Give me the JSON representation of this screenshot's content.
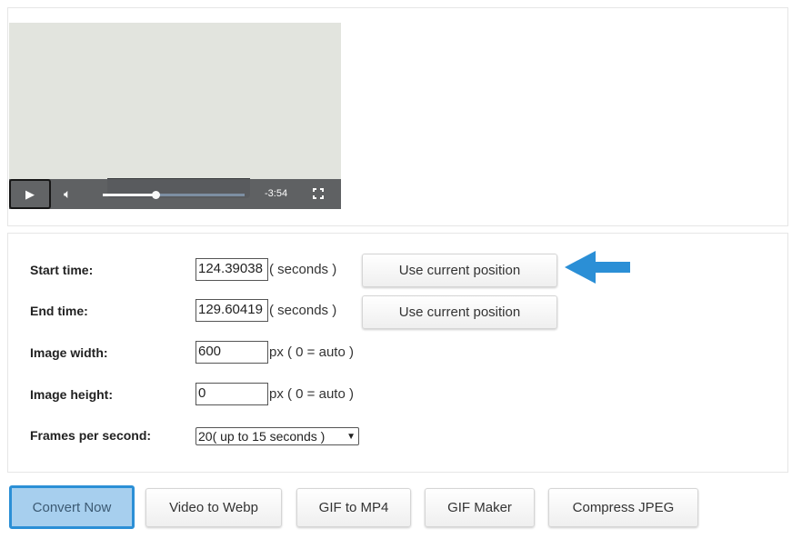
{
  "player": {
    "time_remaining": "-3:54",
    "progress_percent": 37,
    "play_icon": "play-icon",
    "volume_icon": "volume-icon",
    "fullscreen_icon": "fullscreen-icon"
  },
  "form": {
    "start": {
      "label": "Start time:",
      "value": "124.39038",
      "unit": "( seconds )",
      "button": "Use current position"
    },
    "end": {
      "label": "End time:",
      "value": "129.60419",
      "unit": "( seconds )",
      "button": "Use current position"
    },
    "width": {
      "label": "Image width:",
      "value": "600",
      "unit": "px ( 0 = auto )"
    },
    "height": {
      "label": "Image height:",
      "value": "0",
      "unit": "px ( 0 = auto )"
    },
    "fps": {
      "label": "Frames per second:",
      "selected": "20( up to 15 seconds )"
    }
  },
  "arrow_color": "#2b8fd6",
  "actions": [
    "Convert Now",
    "Video to Webp",
    "GIF to MP4",
    "GIF Maker",
    "Compress JPEG"
  ]
}
